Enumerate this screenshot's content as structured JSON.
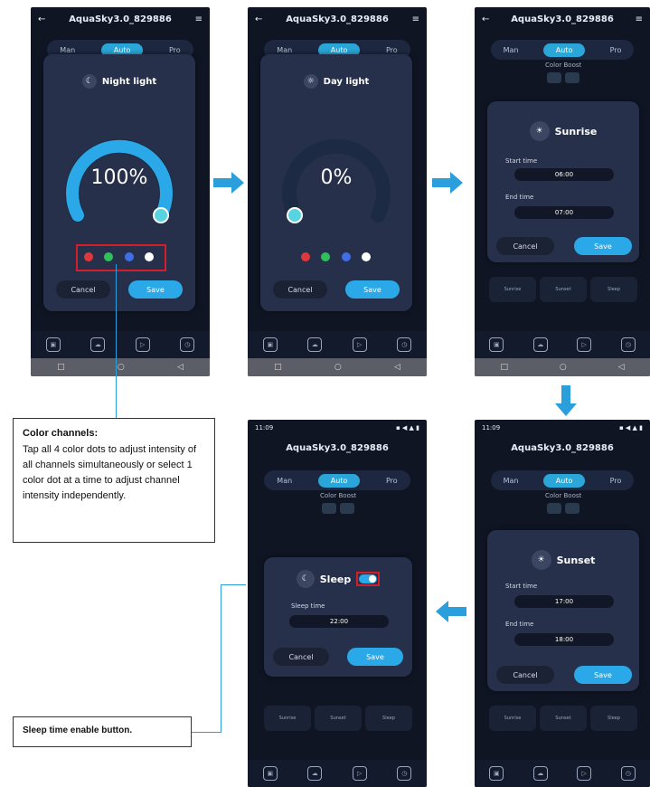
{
  "app": {
    "title": "AquaSky3.0_829886",
    "tabs": [
      "Man",
      "Auto",
      "Pro"
    ],
    "color_boost_label": "Color Boost",
    "status_time": "11:09",
    "bottom_nav": [
      "Export",
      "Sign-up",
      "Preview",
      "Time"
    ]
  },
  "screen1": {
    "dialog_title": "Night light",
    "percent": "100%",
    "intensity_fraction": 1.0,
    "cancel": "Cancel",
    "save": "Save"
  },
  "screen2": {
    "dialog_title": "Day light",
    "percent": "0%",
    "intensity_fraction": 0.0,
    "cancel": "Cancel",
    "save": "Save"
  },
  "screen3": {
    "dialog_title": "Sunrise",
    "start_label": "Start time",
    "start_value": "06:00",
    "end_label": "End time",
    "end_value": "07:00",
    "cancel": "Cancel",
    "save": "Save"
  },
  "screen4": {
    "dialog_title": "Sunset",
    "start_label": "Start time",
    "start_value": "17:00",
    "end_label": "End time",
    "end_value": "18:00",
    "cancel": "Cancel",
    "save": "Save"
  },
  "screen5": {
    "dialog_title": "Sleep",
    "time_label": "Sleep time",
    "time_value": "22:00",
    "cancel": "Cancel",
    "save": "Save"
  },
  "schedule_cards": [
    "Sunrise",
    "Sunset",
    "Sleep"
  ],
  "callout_color": {
    "title": "Color channels:",
    "body": "Tap all 4 color dots to adjust intensity of all channels simultaneously or select 1 color dot at a time to adjust channel intensity independently."
  },
  "callout_sleep": {
    "text": "Sleep time enable button."
  },
  "colors": {
    "accent": "#2aa8e8",
    "arrow": "#2b9fdc",
    "highlight": "#d21f2a",
    "dot_red": "#e0373d",
    "dot_green": "#2fbf5b",
    "dot_blue": "#3f6ee8",
    "dot_white": "#ffffff"
  }
}
